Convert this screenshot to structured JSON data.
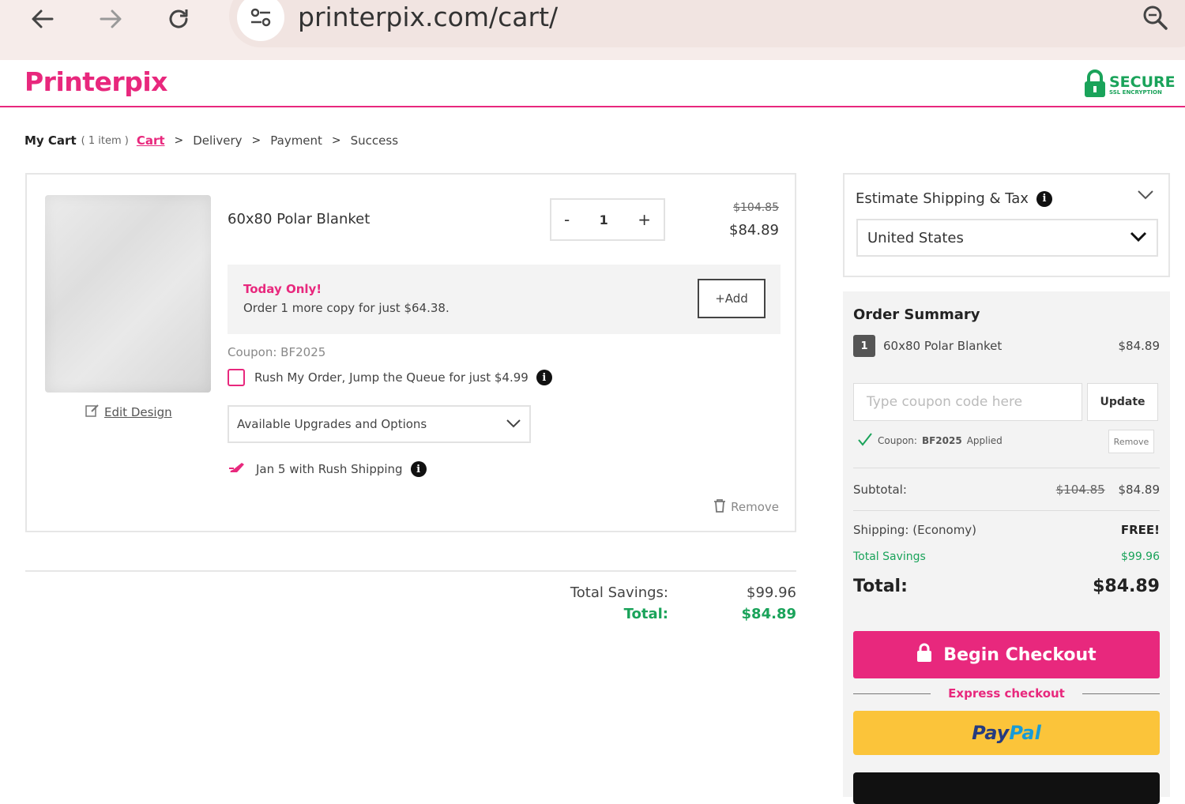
{
  "browser": {
    "url": "printerpix.com/cart/"
  },
  "header": {
    "logo": "Printerpix",
    "secure_text": "SECURE",
    "secure_sub": "SSL ENCRYPTION"
  },
  "breadcrumb": {
    "my_cart": "My Cart",
    "count": "( 1 item )",
    "steps": [
      "Cart",
      "Delivery",
      "Payment",
      "Success"
    ]
  },
  "cart_item": {
    "name": "60x80 Polar Blanket",
    "quantity": "1",
    "minus": "-",
    "plus": "+",
    "price_old": "$104.85",
    "price_new": "$84.89",
    "edit_design": "Edit Design",
    "promo_heading": "Today Only!",
    "promo_text": "Order 1 more copy for just $64.38.",
    "add_label": "+Add",
    "coupon_line": "Coupon: BF2025",
    "rush_label": "Rush My Order, Jump the Queue for just $4.99",
    "upgrades_label": "Available Upgrades and Options",
    "ship_date": "Jan 5 with Rush Shipping",
    "remove_label": "Remove"
  },
  "cart_totals": {
    "savings_label": "Total Savings:",
    "savings_value": "$99.96",
    "total_label": "Total:",
    "total_value": "$84.89"
  },
  "shipping": {
    "title": "Estimate Shipping & Tax",
    "country": "United States"
  },
  "summary": {
    "title": "Order Summary",
    "item_qty": "1",
    "item_name": "60x80 Polar Blanket",
    "item_price": "$84.89",
    "coupon_placeholder": "Type coupon code here",
    "update_label": "Update",
    "applied_prefix": "Coupon:",
    "applied_code": "BF2025",
    "applied_suffix": "Applied",
    "remove_label": "Remove",
    "subtotal_label": "Subtotal:",
    "subtotal_old": "$104.85",
    "subtotal_new": "$84.89",
    "shipping_label": "Shipping: (Economy)",
    "shipping_value": "FREE!",
    "savings_label": "Total Savings",
    "savings_value": "$99.96",
    "total_label": "Total:",
    "total_value": "$84.89",
    "checkout_label": "Begin Checkout",
    "express_label": "Express checkout",
    "paypal_a": "Pay",
    "paypal_b": "Pal"
  },
  "colors": {
    "brand": "#e8287d",
    "success": "#1aa35a",
    "paypal_yellow": "#fbc43a"
  }
}
